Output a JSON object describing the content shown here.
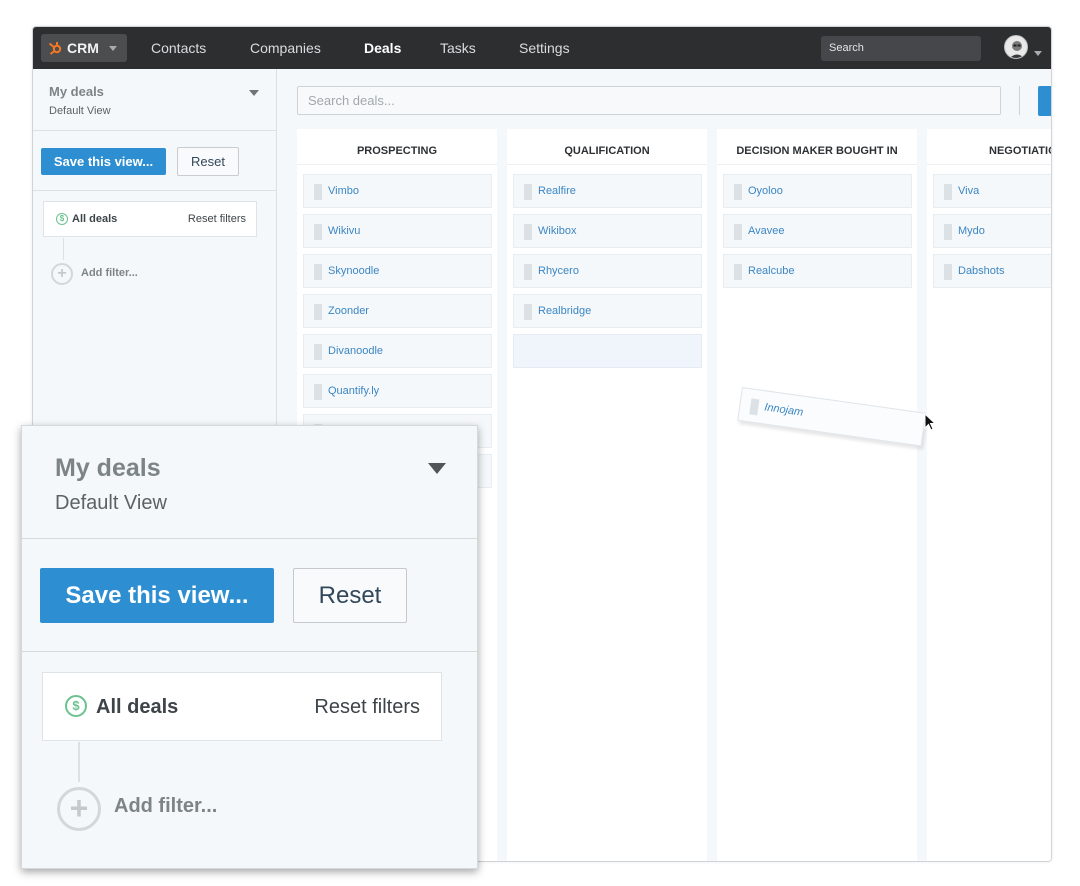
{
  "topbar": {
    "app_label": "CRM",
    "nav": [
      "Contacts",
      "Companies",
      "Deals",
      "Tasks",
      "Settings"
    ],
    "active_nav": "Deals",
    "search_placeholder": "Search"
  },
  "sidebar": {
    "title": "My deals",
    "subtitle": "Default View",
    "save_label": "Save this view...",
    "reset_label": "Reset",
    "filter": {
      "label": "All deals",
      "reset_label": "Reset filters",
      "icon": "dollar-icon"
    },
    "add_filter_label": "Add filter..."
  },
  "board": {
    "search_placeholder": "Search deals...",
    "columns": [
      {
        "title": "PROSPECTING",
        "deals": [
          "Vimbo",
          "Wikivu",
          "Skynoodle",
          "Zoonder",
          "Divanoodle",
          "Quantify.ly"
        ]
      },
      {
        "title": "QUALIFICATION",
        "deals": [
          "Realfire",
          "Wikibox",
          "Rhycero",
          "Realbridge"
        ]
      },
      {
        "title": "DECISION MAKER BOUGHT IN",
        "deals": [
          "Oyoloo",
          "Avavee",
          "Realcube"
        ]
      },
      {
        "title": "NEGOTIATIO",
        "deals": [
          "Viva",
          "Mydo",
          "Dabshots"
        ]
      }
    ],
    "dragging_deal": "Innojam"
  },
  "colors": {
    "topbar": "#2d2e2f",
    "accent": "#2d8ed1",
    "link": "#3b86c4",
    "success": "#6bc28e"
  }
}
